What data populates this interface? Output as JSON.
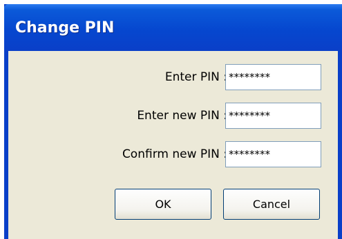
{
  "dialog": {
    "title": "Change PIN",
    "fields": [
      {
        "label": "Enter PIN :",
        "value": "********"
      },
      {
        "label": "Enter new PIN :",
        "value": "********"
      },
      {
        "label": "Confirm new PIN :",
        "value": "********"
      }
    ],
    "buttons": {
      "ok": "OK",
      "cancel": "Cancel"
    }
  }
}
